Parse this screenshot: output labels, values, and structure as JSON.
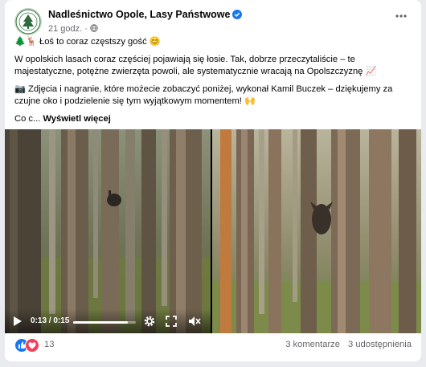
{
  "post": {
    "page_name": "Nadleśnictwo Opole, Lasy Państwowe",
    "time": "21 godz.",
    "separator": "·",
    "line1_emoji_tree": "🌲",
    "line1_emoji_deer": "🦌",
    "line1_text": "Łoś to coraz częstszy gość",
    "line1_emoji_smile": "😊",
    "paragraph1": "W opolskich lasach coraz częściej pojawiają się łosie. Tak, dobrze przeczytaliście – te majestatyczne, potężne zwierzęta powoli, ale systematycznie wracają na Opolszczyznę",
    "paragraph1_emoji": "📈",
    "paragraph2_emoji": "📷",
    "paragraph2": "Zdjęcia i nagranie, które możecie zobaczyć poniżej, wykonał Kamil Buczek – dziękujemy za czujne oko i podzielenie się tym wyjątkowym momentem!",
    "paragraph2_end_emoji": "🙌",
    "truncated_text": "Co c...",
    "see_more_label": "Wyświetl więcej"
  },
  "video": {
    "time_display": "0:13 / 0:15",
    "progress": 0.87
  },
  "footer": {
    "reaction_count": "13",
    "comments": "3 komentarze",
    "shares": "3 udostępnienia"
  },
  "colors": {
    "like": "#1877f2",
    "love": "#f33e58",
    "verified": "#1877f2",
    "secondary_text": "#65676b"
  },
  "icons": [
    "avatar-logo",
    "verified-icon",
    "globe-icon",
    "more-options-icon",
    "play-icon",
    "settings-icon",
    "fullscreen-icon",
    "volume-icon",
    "like-icon",
    "love-icon"
  ]
}
